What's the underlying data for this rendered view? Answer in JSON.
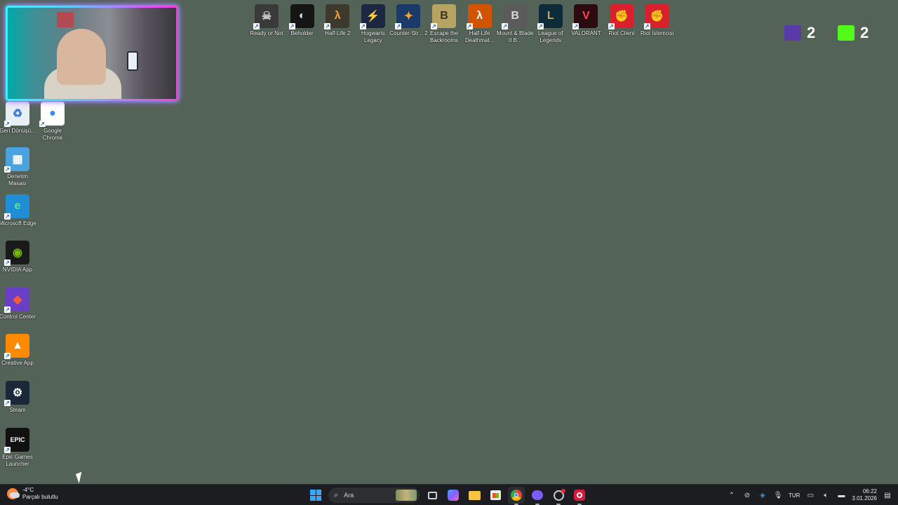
{
  "desktop": {
    "top_icons": [
      {
        "name": "ready-or-not-icon",
        "label": "Ready or Not",
        "bg": "#3a3a3a",
        "glyph": "☠",
        "fg": "#cfcfcf"
      },
      {
        "name": "beholder-icon",
        "label": "Beholder",
        "bg": "#151515",
        "glyph": "◐",
        "fg": "#dddddd"
      },
      {
        "name": "half-life-2-icon",
        "label": "Half-Life 2",
        "bg": "#3d3a2d",
        "glyph": "λ",
        "fg": "#f2a33a"
      },
      {
        "name": "hogwarts-legacy-icon",
        "label": "Hogwarts Legacy",
        "bg": "#1c2742",
        "glyph": "⚡",
        "fg": "#c9b878"
      },
      {
        "name": "counter-strike-2-icon",
        "label": "Counter-Str... 2",
        "bg": "#1a3a6b",
        "glyph": "✦",
        "fg": "#f5a524"
      },
      {
        "name": "escape-the-backrooms-icon",
        "label": "Escape the Backrooms",
        "bg": "#b7a463",
        "glyph": "B",
        "fg": "#3a331d"
      },
      {
        "name": "half-life-deathmatch-icon",
        "label": "Half-Life Deathmat...",
        "bg": "#d35400",
        "glyph": "λ",
        "fg": "#ffffff"
      },
      {
        "name": "mount-and-blade-icon",
        "label": "Mount & Blade II B...",
        "bg": "#5b5b5b",
        "glyph": "B",
        "fg": "#d8d8d8"
      },
      {
        "name": "league-of-legends-icon",
        "label": "League of Legends",
        "bg": "#0d2b3b",
        "glyph": "L",
        "fg": "#c8a85a"
      },
      {
        "name": "valorant-icon",
        "label": "VALORANT",
        "bg": "#2b0a10",
        "glyph": "V",
        "fg": "#ff4655"
      },
      {
        "name": "riot-client-icon",
        "label": "Riot Client",
        "bg": "#d9202c",
        "glyph": "✊",
        "fg": "#ffffff"
      },
      {
        "name": "riot-istemcisi-icon",
        "label": "Riot İstemcisi",
        "bg": "#d9202c",
        "glyph": "✊",
        "fg": "#ffffff"
      }
    ],
    "left_icons": [
      {
        "name": "recycle-bin-icon",
        "label": "Geri Dönüşü...",
        "bg": "#e8eef5",
        "glyph": "♻",
        "fg": "#3a7bd5"
      },
      {
        "name": "google-chrome-icon",
        "label": "Google Chrome",
        "bg": "#ffffff",
        "glyph": "●",
        "fg": "#4285f4"
      },
      {
        "name": "control-panel-icon",
        "label": "Denetim Masası",
        "bg": "#4aa3df",
        "glyph": "▦",
        "fg": "#ffffff"
      },
      {
        "name": "microsoft-edge-icon",
        "label": "Microsoft Edge",
        "bg": "#1e8fd6",
        "glyph": "e",
        "fg": "#5fe38c"
      },
      {
        "name": "nvidia-app-icon",
        "label": "NVIDIA App",
        "bg": "#1a1a1a",
        "glyph": "◉",
        "fg": "#76b900"
      },
      {
        "name": "control-center-icon",
        "label": "Control Center",
        "bg": "#6a3fc8",
        "glyph": "◆",
        "fg": "#ff5a3c"
      },
      {
        "name": "creative-app-icon",
        "label": "Creative App",
        "bg": "#ff8a00",
        "glyph": "▲",
        "fg": "#ffffff"
      },
      {
        "name": "steam-icon",
        "label": "Steam",
        "bg": "#1b2838",
        "glyph": "⚙",
        "fg": "#ffffff"
      },
      {
        "name": "epic-games-icon",
        "label": "Epic Games Launcher",
        "bg": "#111111",
        "glyph": "EPIC",
        "fg": "#ffffff"
      }
    ]
  },
  "counters": [
    {
      "name": "twitch-counter",
      "value": "2",
      "color": "#5a3aa8"
    },
    {
      "name": "kick-counter",
      "value": "2",
      "color": "#53fc18"
    }
  ],
  "taskbar": {
    "weather": {
      "temp": "-4°C",
      "desc": "Parçalı bulutlu"
    },
    "search_placeholder": "Ara",
    "language": "TUR",
    "time": "06:22",
    "date": "3.01.2026"
  }
}
